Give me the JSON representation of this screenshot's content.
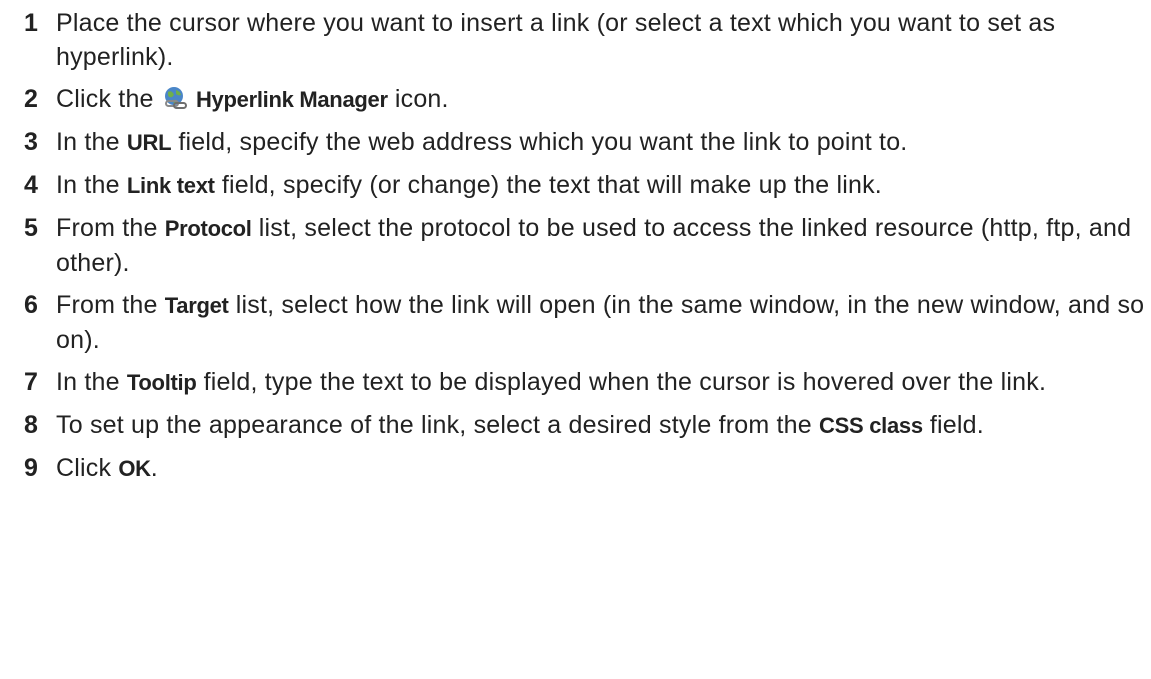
{
  "steps": [
    {
      "num": "1",
      "parts": [
        {
          "t": "Place the cursor where you want to insert a link (or select a text which you want to set as hyperlink)."
        }
      ]
    },
    {
      "num": "2",
      "parts": [
        {
          "t": "Click the "
        },
        {
          "icon": "hyperlink-manager-icon"
        },
        {
          "t": " "
        },
        {
          "b": "Hyperlink Manager"
        },
        {
          "t": " icon."
        }
      ]
    },
    {
      "num": "3",
      "parts": [
        {
          "t": "In the "
        },
        {
          "b": "URL"
        },
        {
          "t": " field, specify the web address which you want the link to point to."
        }
      ]
    },
    {
      "num": "4",
      "parts": [
        {
          "t": "In the "
        },
        {
          "b": "Link text"
        },
        {
          "t": " field, specify (or change) the text that will make up the link."
        }
      ]
    },
    {
      "num": "5",
      "parts": [
        {
          "t": "From the "
        },
        {
          "b": "Protocol"
        },
        {
          "t": " list, select the protocol to be used to access the linked resource (http, ftp, and other)."
        }
      ]
    },
    {
      "num": "6",
      "parts": [
        {
          "t": "From the "
        },
        {
          "b": "Target"
        },
        {
          "t": " list, select how the link will open (in the same window, in the new window, and so on)."
        }
      ]
    },
    {
      "num": "7",
      "parts": [
        {
          "t": "In the "
        },
        {
          "b": "Tooltip"
        },
        {
          "t": " field, type the text to be displayed when the cursor is hovered over the link."
        }
      ]
    },
    {
      "num": "8",
      "parts": [
        {
          "t": "To set up the appearance of the link, select a desired style from the "
        },
        {
          "b": "CSS class"
        },
        {
          "t": " field."
        }
      ]
    },
    {
      "num": "9",
      "parts": [
        {
          "t": "Click "
        },
        {
          "b": "OK"
        },
        {
          "t": "."
        }
      ]
    }
  ]
}
